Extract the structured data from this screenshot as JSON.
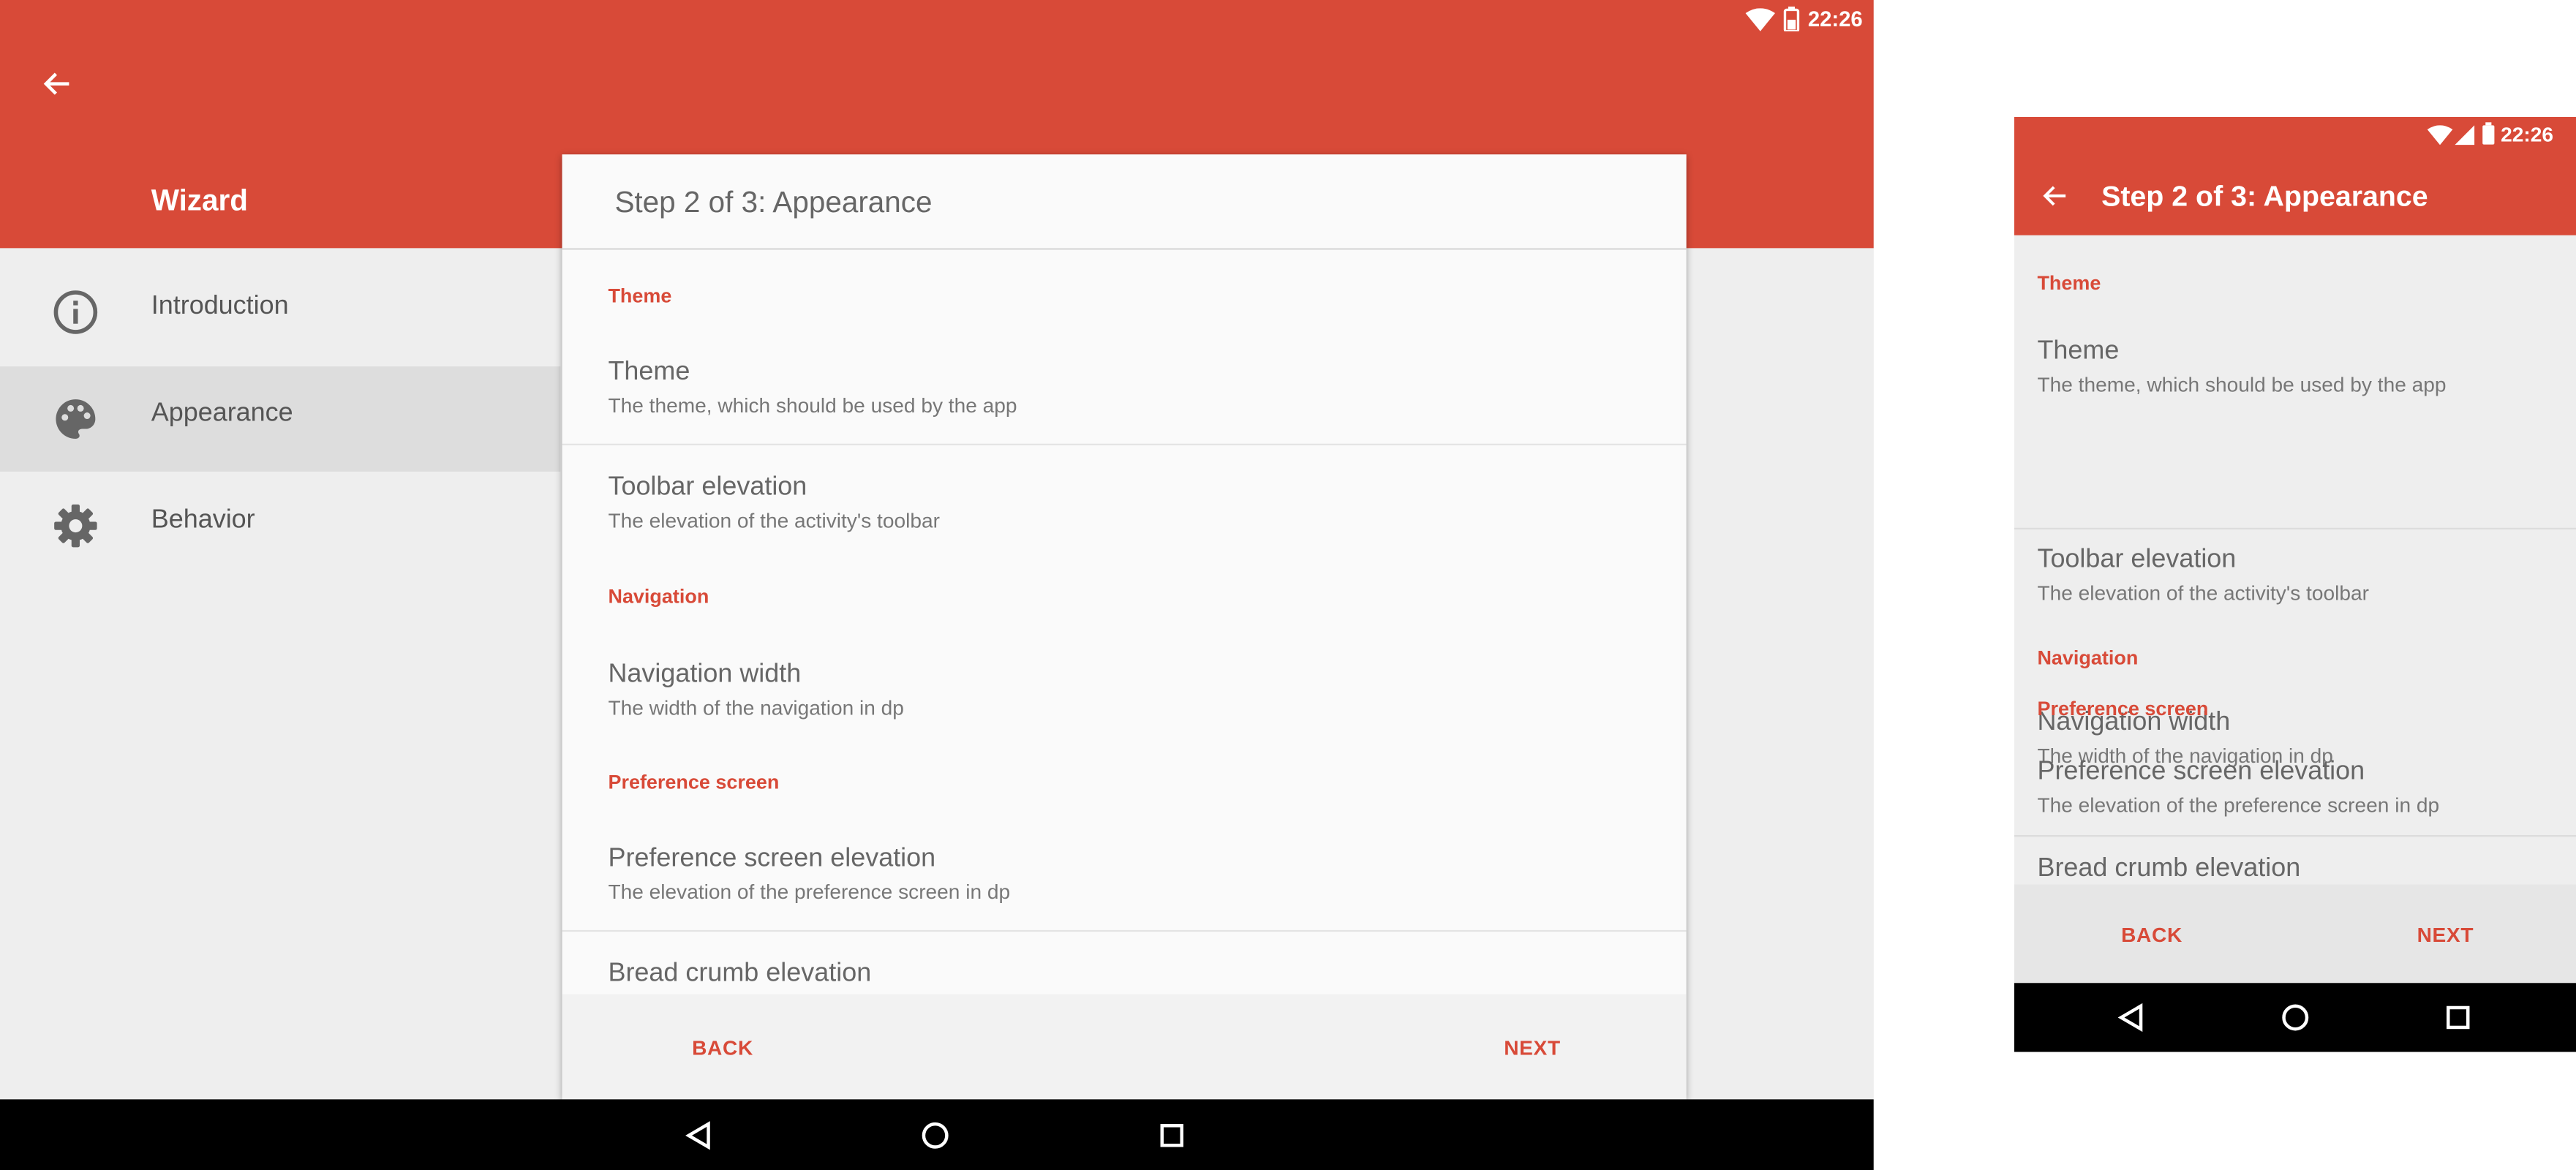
{
  "status_bar": {
    "time": "22:26"
  },
  "sidebar": {
    "title": "Wizard",
    "items": [
      {
        "label": "Introduction",
        "icon": "info-icon"
      },
      {
        "label": "Appearance",
        "icon": "palette-icon",
        "selected": true
      },
      {
        "label": "Behavior",
        "icon": "gear-icon"
      }
    ]
  },
  "dialog": {
    "title": "Step 2 of 3: Appearance",
    "categories": [
      {
        "label": "Theme",
        "prefs": [
          {
            "title": "Theme",
            "summary": "The theme, which should be used by the app"
          },
          {
            "title": "Toolbar elevation",
            "summary": "The elevation of the activity's toolbar"
          }
        ]
      },
      {
        "label": "Navigation",
        "prefs": [
          {
            "title": "Navigation width",
            "summary": "The width of the navigation in dp"
          }
        ]
      },
      {
        "label": "Preference screen",
        "prefs": [
          {
            "title": "Preference screen elevation",
            "summary": "The elevation of the preference screen in dp"
          },
          {
            "title": "Bread crumb elevation",
            "summary": ""
          }
        ]
      }
    ],
    "back_label": "BACK",
    "next_label": "NEXT"
  },
  "colors": {
    "accent": "#d84a38",
    "toolbar": "#d84a38",
    "background": "#eeeeee",
    "nav_bar": "#000000"
  }
}
